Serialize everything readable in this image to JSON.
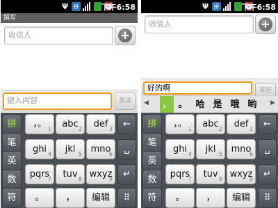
{
  "status": {
    "time": "下午6:58",
    "ime_badge": "拼"
  },
  "left": {
    "title": "撰写",
    "recipient_placeholder": "收信人",
    "add_label": "+",
    "message_placeholder": "键入内容",
    "send_label": "发送"
  },
  "right": {
    "recipient_placeholder": "收信人",
    "add_label": "+",
    "message_text": "好的啊",
    "send_label": "发送",
    "candidates": [
      "，",
      "。",
      "哈",
      "是",
      "哦",
      "哟"
    ],
    "cand_prev": "◀",
    "cand_next": "▶"
  },
  "keyboard": {
    "side_keys": [
      "拼",
      "笔",
      "英",
      "数",
      "符"
    ],
    "rows": [
      [
        {
          "label": "，。",
          "num": "1"
        },
        {
          "label": "abc",
          "num": "2"
        },
        {
          "label": "def",
          "num": "3"
        }
      ],
      [
        {
          "label": "ghi",
          "num": "4"
        },
        {
          "label": "jkl",
          "num": "5"
        },
        {
          "label": "mno",
          "num": "6"
        }
      ],
      [
        {
          "label": "pqrs",
          "num": "7"
        },
        {
          "label": "tuv",
          "num": "8"
        },
        {
          "label": "wxyz",
          "num": "9"
        }
      ],
      [
        {
          "label": "。",
          "num": ""
        },
        {
          "label": "，",
          "num": ""
        },
        {
          "label": "编辑",
          "num": ""
        }
      ]
    ],
    "right_keys": [
      "←",
      "␣",
      "↵",
      "⠿"
    ]
  },
  "colors": {
    "accent_orange": "#f39a1c",
    "candidate_green": "#8cc63f",
    "keyboard_bg": "#4a4f55"
  }
}
